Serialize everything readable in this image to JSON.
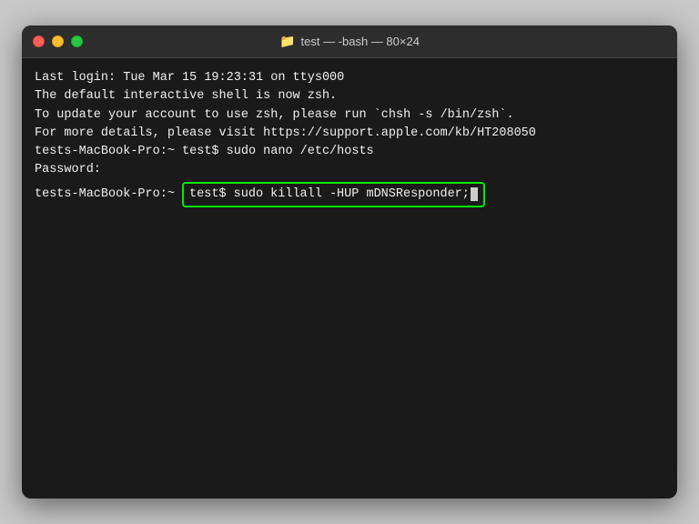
{
  "window": {
    "title": "test — -bash — 80×24",
    "title_icon": "📁"
  },
  "traffic_lights": {
    "close": "close",
    "minimize": "minimize",
    "maximize": "maximize"
  },
  "terminal": {
    "lines": [
      "Last login: Tue Mar 15 19:23:31 on ttys000",
      "",
      "The default interactive shell is now zsh.",
      "To update your account to use zsh, please run `chsh -s /bin/zsh`.",
      "For more details, please visit https://support.apple.com/kb/HT208050",
      "tests-MacBook-Pro:~ test$ sudo nano /etc/hosts",
      "Password:",
      "tests-MacBook-Pro:~ "
    ],
    "highlighted_command": "test$ sudo killall -HUP mDNSResponder;"
  }
}
